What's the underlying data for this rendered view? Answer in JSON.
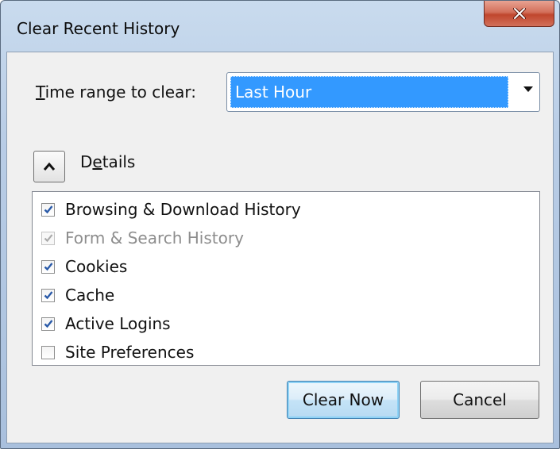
{
  "window": {
    "title": "Clear Recent History",
    "close_glyph": "x"
  },
  "time_range": {
    "label_accel": "T",
    "label_rest": "ime range to clear:",
    "selected": "Last Hour"
  },
  "details": {
    "label_pre": "D",
    "label_accel": "e",
    "label_post": "tails",
    "expanded": true
  },
  "items": [
    {
      "label": "Browsing & Download History",
      "checked": true,
      "enabled": true
    },
    {
      "label": "Form & Search History",
      "checked": true,
      "enabled": false
    },
    {
      "label": "Cookies",
      "checked": true,
      "enabled": true
    },
    {
      "label": "Cache",
      "checked": true,
      "enabled": true
    },
    {
      "label": "Active Logins",
      "checked": true,
      "enabled": true
    },
    {
      "label": "Site Preferences",
      "checked": false,
      "enabled": true
    }
  ],
  "buttons": {
    "clear_now": "Clear Now",
    "cancel": "Cancel"
  },
  "colors": {
    "selection": "#3399ff",
    "check": "#2a5aa8",
    "close": "#c0462d"
  }
}
